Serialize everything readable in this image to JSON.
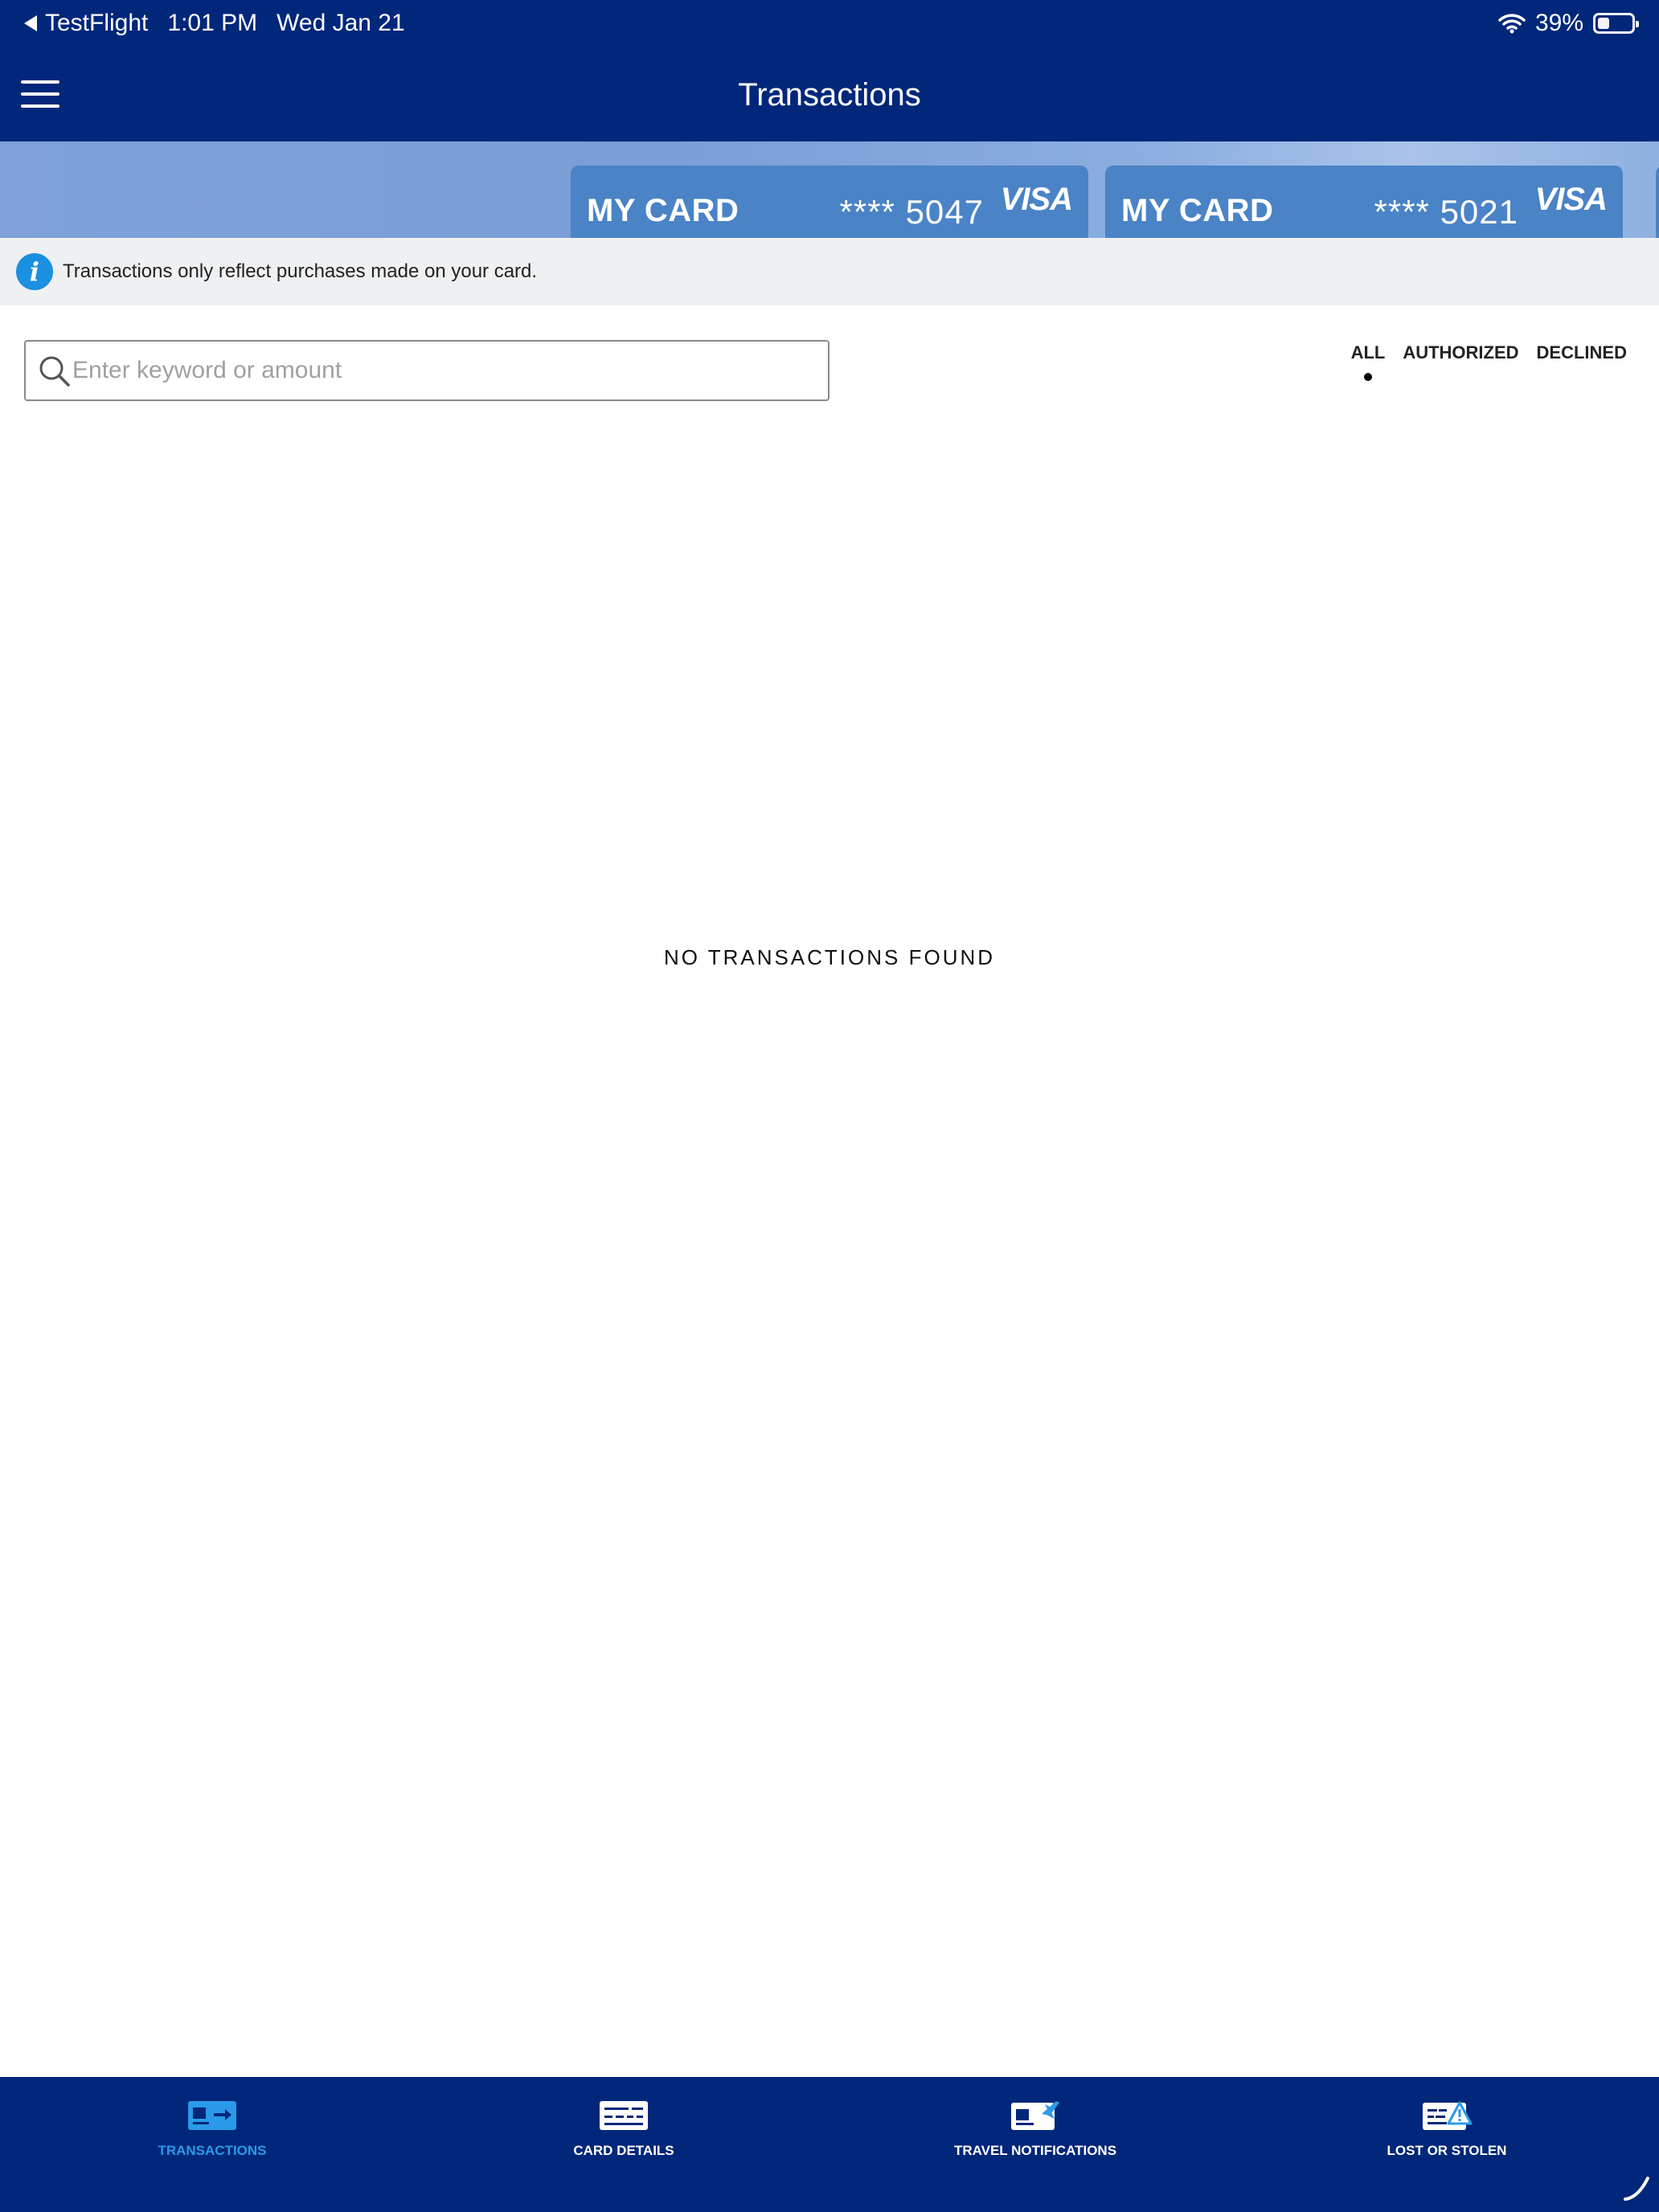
{
  "status_bar": {
    "back_app": "TestFlight",
    "time": "1:01 PM",
    "date": "Wed Jan 21",
    "battery": "39%"
  },
  "nav": {
    "title": "Transactions"
  },
  "cards": [
    {
      "name": "MY CARD",
      "number": "**** 5047",
      "brand": "VISA"
    },
    {
      "name": "MY CARD",
      "number": "**** 5021",
      "brand": "VISA"
    }
  ],
  "info": {
    "text": "Transactions only reflect purchases made on your card."
  },
  "search": {
    "placeholder": "Enter keyword or amount",
    "value": ""
  },
  "filters": {
    "tabs": [
      "ALL",
      "AUTHORIZED",
      "DECLINED"
    ],
    "selected": "ALL"
  },
  "empty_state": "NO TRANSACTIONS FOUND",
  "tab_bar": {
    "items": [
      {
        "label": "TRANSACTIONS",
        "icon": "transactions-icon",
        "active": true
      },
      {
        "label": "CARD DETAILS",
        "icon": "card-details-icon",
        "active": false
      },
      {
        "label": "TRAVEL NOTIFICATIONS",
        "icon": "travel-notifications-icon",
        "active": false
      },
      {
        "label": "LOST OR STOLEN",
        "icon": "lost-stolen-icon",
        "active": false
      }
    ]
  },
  "colors": {
    "brand_navy": "#01277a",
    "accent_blue": "#2a9ae8",
    "card_blue": "#4a83c6",
    "banner_gray": "#eef0f2"
  }
}
